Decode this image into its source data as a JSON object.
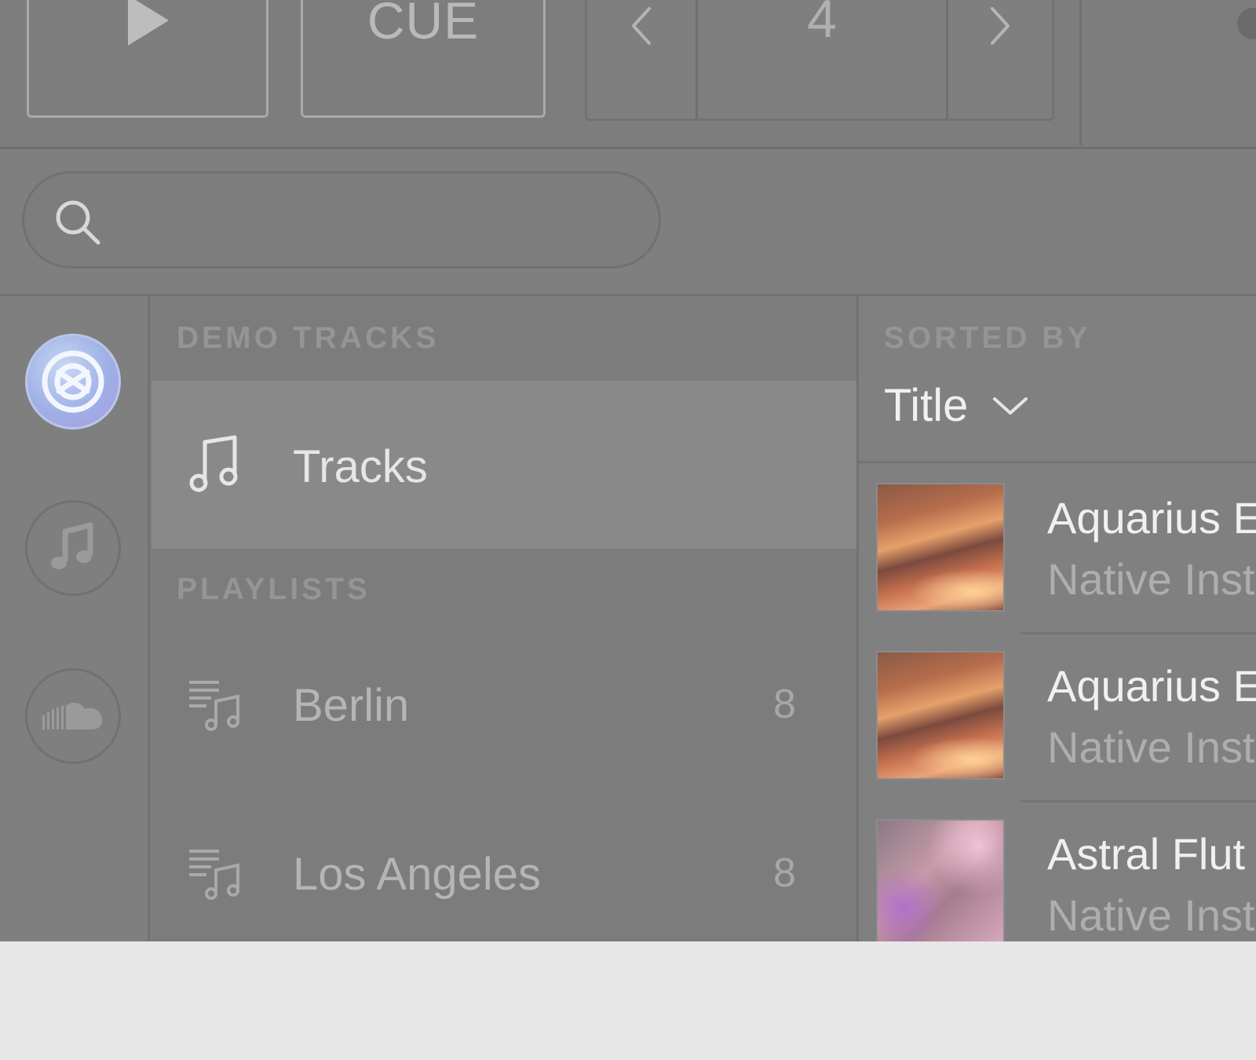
{
  "transport": {
    "cue_label": "CUE",
    "loop_size": "4"
  },
  "search": {
    "placeholder": ""
  },
  "sources": [
    {
      "name": "traktor",
      "icon": "traktor-logo-icon",
      "active": true
    },
    {
      "name": "local-music",
      "icon": "music-note-icon",
      "active": false
    },
    {
      "name": "soundcloud",
      "icon": "soundcloud-icon",
      "active": false
    }
  ],
  "collection": {
    "demo_header": "DEMO TRACKS",
    "tracks_label": "Tracks",
    "playlists_header": "PLAYLISTS",
    "playlists": [
      {
        "label": "Berlin",
        "count": "8"
      },
      {
        "label": "Los Angeles",
        "count": "8"
      }
    ]
  },
  "track_list": {
    "sorted_by_label": "SORTED BY",
    "sort_value": "Title",
    "tracks": [
      {
        "title": "Aquarius E",
        "artist": "Native Inst",
        "art": "amber-abstract"
      },
      {
        "title": "Aquarius E",
        "artist": "Native Inst",
        "art": "amber-abstract"
      },
      {
        "title": "Astral Flut",
        "artist": "Native Inst",
        "art": "pink-abstract"
      }
    ]
  },
  "colors": {
    "app_background": "#818181",
    "selected_row": "#898989",
    "traktor_accent": "#9fb0e6",
    "page_background": "#e7e7e7"
  }
}
